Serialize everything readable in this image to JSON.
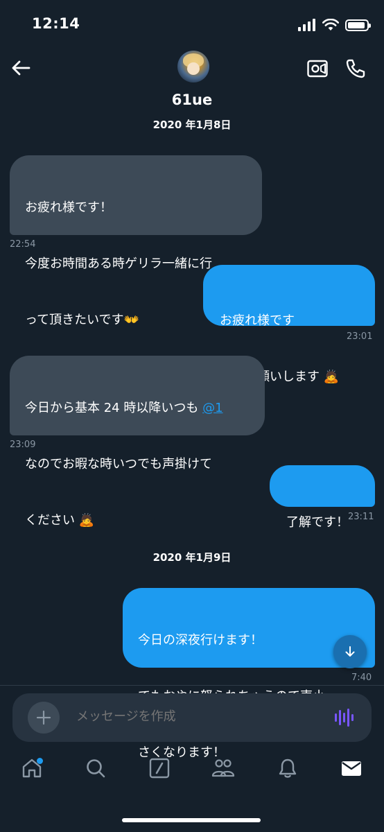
{
  "status_bar": {
    "time": "12:14"
  },
  "header": {
    "contact_name": "61ue"
  },
  "colors": {
    "background": "#15202b",
    "incoming_bubble": "#3d4a57",
    "outgoing_bubble": "#1d9bf0",
    "timestamp": "#8b98a5",
    "accent": "#1d9bf0"
  },
  "conversation": {
    "date_1": "2020 年1月8日",
    "date_2": "2020 年1月9日",
    "messages": [
      {
        "direction": "in",
        "line1": "お疲れ様です！",
        "line2": "今度お時間ある時ゲリラ一緒に行",
        "line3": "って頂きたいです",
        "emoji": "👐",
        "time": "22:54"
      },
      {
        "direction": "out",
        "line1": "お疲れ様です",
        "line2": "ぜひお願いします",
        "emoji": "🙇",
        "time": "23:01"
      },
      {
        "direction": "in",
        "line1": "今日から基本 24 時以降いつも",
        "mention": "@1",
        "line2": "なのでお暇な時いつでも声掛けて",
        "line3": "ください",
        "emoji": "🙇",
        "time": "23:09"
      },
      {
        "direction": "out",
        "line1": "了解です！",
        "time": "23:11"
      },
      {
        "direction": "out",
        "line1": "今日の深夜行けます！",
        "line2": "でもおやに怒られちゃうので声小",
        "line3": "さくなります！",
        "time": "7:40"
      }
    ]
  },
  "composer": {
    "placeholder": "メッセージを作成"
  },
  "tab_bar": {
    "icons": [
      "home-icon",
      "search-icon",
      "compose-icon",
      "communities-icon",
      "notifications-icon",
      "messages-icon"
    ]
  }
}
